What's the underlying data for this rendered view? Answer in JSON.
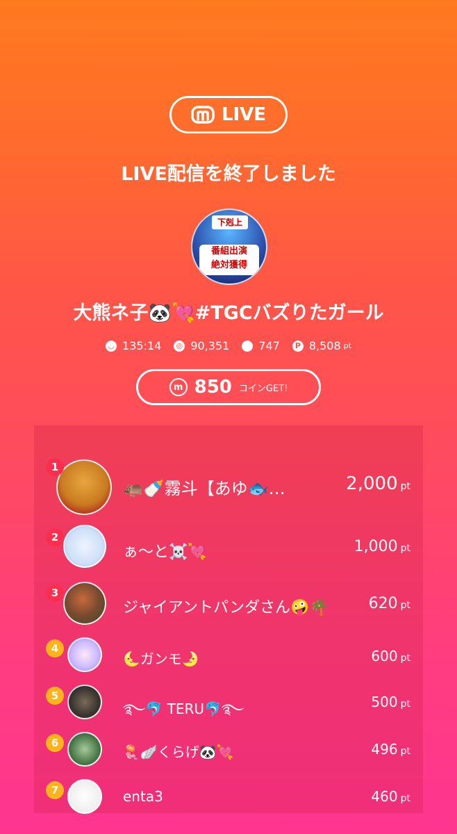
{
  "brand": {
    "label": "LIVE"
  },
  "headline": "LIVE配信を終了しました",
  "host": {
    "name": "大熊ネ子🐼💘#TGCバズりたガール",
    "avatar_text_top": "下剋上",
    "avatar_text_main": "番組出演\n絶対獲得"
  },
  "stats": {
    "duration": "135:14",
    "viewers": "90,351",
    "comments": "747",
    "points": "8,508",
    "points_unit": "pt"
  },
  "coins": {
    "amount": "850",
    "label": "コインGET!"
  },
  "ranking": [
    {
      "rank": "1",
      "name": "🦛🍼霧斗【あゆ🐟…",
      "points": "2,000",
      "unit": "pt"
    },
    {
      "rank": "2",
      "name": "ぁ〜と☠️💘",
      "points": "1,000",
      "unit": "pt"
    },
    {
      "rank": "3",
      "name": "ジャイアントパンダさん🤪🌴",
      "points": "620",
      "unit": "pt"
    },
    {
      "rank": "4",
      "name": "🌜ガンモ🌛",
      "points": "600",
      "unit": "pt"
    },
    {
      "rank": "5",
      "name": "࿐🐬 TERU🐬࿐",
      "points": "500",
      "unit": "pt"
    },
    {
      "rank": "6",
      "name": "🪼🪽くらげ🐼💘",
      "points": "496",
      "unit": "pt"
    },
    {
      "rank": "7",
      "name": "enta3",
      "points": "460",
      "unit": "pt"
    }
  ],
  "colors": {
    "rank_top": "#ff2e4f",
    "rank_low": "#ffb31c"
  }
}
